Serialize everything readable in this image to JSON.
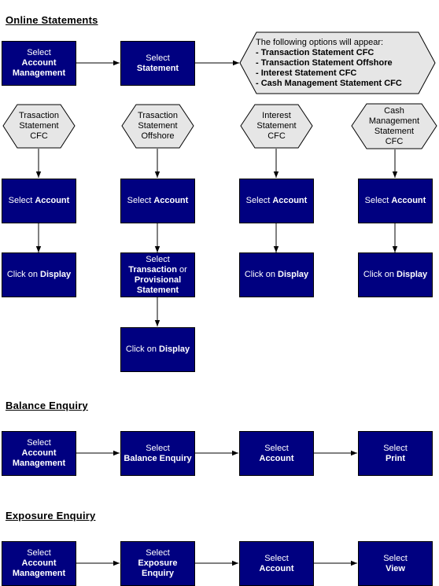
{
  "sections": {
    "online": {
      "title": "Online Statements",
      "step1": {
        "line1": "Select",
        "line2": "Account",
        "line3": "Management"
      },
      "step2": {
        "line1": "Select",
        "line2": "Statement"
      },
      "options_note": {
        "intro": "The following options will appear:",
        "options": [
          "- Transaction Statement CFC",
          "- Transaction Statement Offshore",
          "- Interest Statement CFC",
          "- Cash Management Statement CFC"
        ]
      },
      "branches": [
        {
          "hex": [
            "Trasaction",
            "Statement",
            "CFC"
          ],
          "select_account": {
            "prefix": "Select ",
            "bold": "Account"
          },
          "display": {
            "prefix": "Click on ",
            "bold": "Display"
          }
        },
        {
          "hex": [
            "Trasaction",
            "Statement",
            "Offshore"
          ],
          "select_account": {
            "prefix": "Select ",
            "bold": "Account"
          },
          "select_type": {
            "line1": "Select",
            "line2_bold": "Transaction",
            "line2_rest": " or",
            "line3": "Provisional",
            "line4": "Statement"
          },
          "display": {
            "prefix": "Click on ",
            "bold": "Display"
          }
        },
        {
          "hex": [
            "Interest",
            "Statement",
            "CFC"
          ],
          "select_account": {
            "prefix": "Select ",
            "bold": "Account"
          },
          "display": {
            "prefix": "Click on ",
            "bold": "Display"
          }
        },
        {
          "hex": [
            "Cash",
            "Management",
            "Statement",
            "CFC"
          ],
          "select_account": {
            "prefix": "Select ",
            "bold": "Account"
          },
          "display": {
            "prefix": "Click on ",
            "bold": "Display"
          }
        }
      ]
    },
    "balance": {
      "title": "Balance Enquiry",
      "steps": [
        {
          "line1": "Select",
          "bold": [
            "Account",
            "Management"
          ]
        },
        {
          "line1": "Select",
          "bold": [
            "Balance Enquiry"
          ]
        },
        {
          "line1": "Select",
          "bold": [
            "Account"
          ]
        },
        {
          "line1": "Select",
          "bold": [
            "Print"
          ]
        }
      ]
    },
    "exposure": {
      "title": "Exposure Enquiry",
      "steps": [
        {
          "line1": "Select",
          "bold": [
            "Account",
            "Management"
          ]
        },
        {
          "line1": "Select",
          "bold": [
            "Exposure",
            "Enquiry"
          ]
        },
        {
          "line1": "Select",
          "bold": [
            "Account"
          ]
        },
        {
          "line1": "Select",
          "bold": [
            "View"
          ]
        }
      ]
    }
  },
  "colors": {
    "box_fill": "#000080",
    "hex_fill": "#e6e6e6",
    "line": "#000000",
    "text_on_box": "#ffffff"
  }
}
